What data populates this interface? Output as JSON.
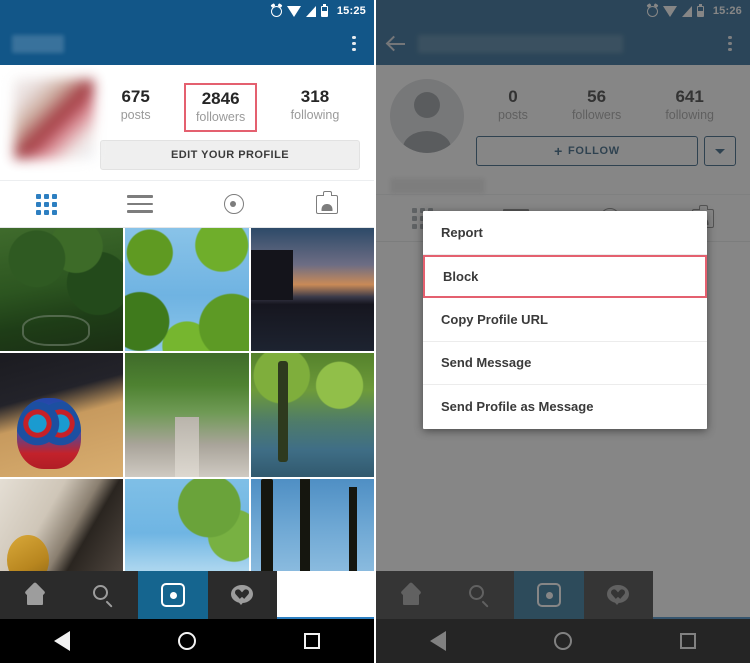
{
  "left": {
    "status": {
      "time": "15:25",
      "icons": [
        "alarm-icon",
        "wifi-icon",
        "signal-icon",
        "battery-icon"
      ]
    },
    "appbar": {
      "username_blurred": "",
      "menu_icon": "kebab-menu-icon"
    },
    "profile": {
      "avatar": "blurred-profile-photo",
      "stats": [
        {
          "num": "675",
          "label": "posts",
          "highlighted": false
        },
        {
          "num": "2846",
          "label": "followers",
          "highlighted": true
        },
        {
          "num": "318",
          "label": "following",
          "highlighted": false
        }
      ],
      "button_label": "EDIT YOUR PROFILE"
    },
    "tabs": [
      {
        "icon": "grid-icon",
        "active": true
      },
      {
        "icon": "list-icon",
        "active": false
      },
      {
        "icon": "location-pin-icon",
        "active": false
      },
      {
        "icon": "tagged-photos-icon",
        "active": false
      }
    ],
    "photos": [
      "ivy-wall-with-bicycle",
      "tree-canopy-blue-sky",
      "river-city-sunset",
      "colorful-mask-on-desk",
      "tree-lined-path",
      "willows-over-water",
      "hand-holding-gold-medal",
      "branch-against-blue-sky",
      "silhouetted-trees"
    ],
    "bottom_nav": [
      {
        "icon": "home-icon",
        "active": false
      },
      {
        "icon": "search-icon",
        "active": false
      },
      {
        "icon": "camera-icon",
        "active": true
      },
      {
        "icon": "activity-heart-icon",
        "active": false
      },
      {
        "icon": "profile-person-icon",
        "active": true
      }
    ],
    "system_nav": [
      "back-icon",
      "home-icon",
      "recents-icon"
    ]
  },
  "right": {
    "status": {
      "time": "15:26",
      "icons": [
        "alarm-icon",
        "wifi-icon",
        "signal-icon",
        "battery-icon"
      ]
    },
    "appbar": {
      "back_icon": "back-arrow-icon",
      "username_blurred": "",
      "menu_icon": "kebab-menu-icon"
    },
    "profile": {
      "avatar": "default-person-avatar",
      "stats": [
        {
          "num": "0",
          "label": "posts",
          "highlighted": false
        },
        {
          "num": "56",
          "label": "followers",
          "highlighted": false
        },
        {
          "num": "641",
          "label": "following",
          "highlighted": false
        }
      ],
      "follow_label": "FOLLOW",
      "follow_plus": "+",
      "follow_caret": "chevron-down-icon"
    },
    "menu": {
      "items": [
        {
          "label": "Report",
          "highlighted": false
        },
        {
          "label": "Block",
          "highlighted": true
        },
        {
          "label": "Copy Profile URL",
          "highlighted": false
        },
        {
          "label": "Send Message",
          "highlighted": false
        },
        {
          "label": "Send Profile as Message",
          "highlighted": false
        }
      ]
    },
    "bottom_nav": [
      {
        "icon": "home-icon",
        "active": false
      },
      {
        "icon": "search-icon",
        "active": false
      },
      {
        "icon": "camera-icon",
        "active": true
      },
      {
        "icon": "activity-heart-icon",
        "active": false
      },
      {
        "icon": "profile-person-icon",
        "active": true
      }
    ],
    "system_nav": [
      "back-icon",
      "home-icon",
      "recents-icon"
    ]
  },
  "colors": {
    "header_blue": "#125688",
    "accent_blue": "#2d7fc1",
    "highlight_red": "#e4606f",
    "nav_dark": "#2b2b2b"
  }
}
